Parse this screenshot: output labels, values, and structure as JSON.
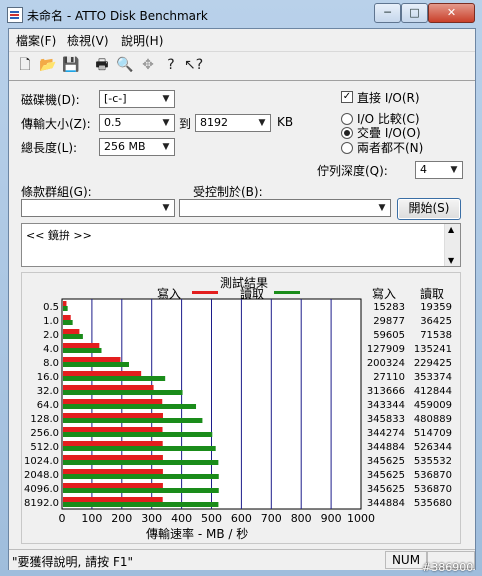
{
  "window": {
    "title": "未命名 - ATTO Disk Benchmark",
    "minimize": "─",
    "maximize": "□",
    "close": "✕"
  },
  "menu": [
    "檔案(F)",
    "檢視(V)",
    "說明(H)"
  ],
  "toolbar_icons": [
    "new-file-icon",
    "open-folder-icon",
    "save-icon",
    "print-icon",
    "print-preview-icon",
    "move-icon",
    "help-icon",
    "context-help-icon"
  ],
  "form": {
    "drive_label": "磁碟機(D):",
    "drive_value": "[-c-]",
    "transfer_label": "傳輸大小(Z):",
    "transfer_from": "0.5",
    "transfer_to_label": "到",
    "transfer_to": "8192",
    "transfer_unit": "KB",
    "length_label": "總長度(L):",
    "length_value": "256 MB",
    "direct_io_label": "直接 I/O(R)",
    "direct_io_checked": true,
    "radio_options": [
      "I/O 比較(C)",
      "交疊 I/O(O)",
      "兩者都不(N)"
    ],
    "radio_selected": 1,
    "queue_label": "佇列深度(Q):",
    "queue_value": "4",
    "controlled_group_label": "條款群組(G):",
    "controlled_by_label": "受控制於(B):",
    "start_button": "開始(S)",
    "description": "<< 鏡拚 >>"
  },
  "results": {
    "title": "測試結果",
    "legend_write": "寫入",
    "legend_read": "讀取",
    "col_write": "寫入",
    "col_read": "讀取",
    "xlabel": "傳輸速率 - MB / 秒"
  },
  "chart_data": {
    "type": "bar",
    "title": "測試結果",
    "xlabel": "傳輸速率 - MB / 秒",
    "categories": [
      "0.5",
      "1.0",
      "2.0",
      "4.0",
      "8.0",
      "16.0",
      "32.0",
      "64.0",
      "128.0",
      "256.0",
      "512.0",
      "1024.0",
      "2048.0",
      "4096.0",
      "8192.0"
    ],
    "series": [
      {
        "name": "寫入",
        "color": "#e31e1e",
        "values": [
          15283,
          29877,
          59605,
          127909,
          200324,
          271100,
          313666,
          343344,
          345833,
          344274,
          344884,
          345625,
          345625,
          345625,
          344884
        ]
      },
      {
        "name": "讀取",
        "color": "#1a8c1a",
        "values": [
          19359,
          36425,
          71538,
          135241,
          229425,
          353374,
          412844,
          459009,
          480889,
          514709,
          526344,
          535532,
          536870,
          536870,
          535680
        ]
      }
    ],
    "write_labels": [
      "15283",
      "29877",
      "59605",
      "127909",
      "200324",
      "27110",
      "313666",
      "343344",
      "345833",
      "344274",
      "344884",
      "345625",
      "345625",
      "345625",
      "344884"
    ],
    "read_labels": [
      "19359",
      "36425",
      "71538",
      "135241",
      "229425",
      "353374",
      "412844",
      "459009",
      "480889",
      "514709",
      "526344",
      "535532",
      "536870",
      "536870",
      "535680"
    ],
    "xticks": [
      "0",
      "100",
      "200",
      "300",
      "400",
      "500",
      "600",
      "700",
      "800",
      "900",
      "1000"
    ],
    "xlim": [
      0,
      1000
    ],
    "grid": true
  },
  "status": {
    "help": "\"要獲得說明, 請按 F1\"",
    "num": "NUM"
  },
  "watermark": "#386900"
}
